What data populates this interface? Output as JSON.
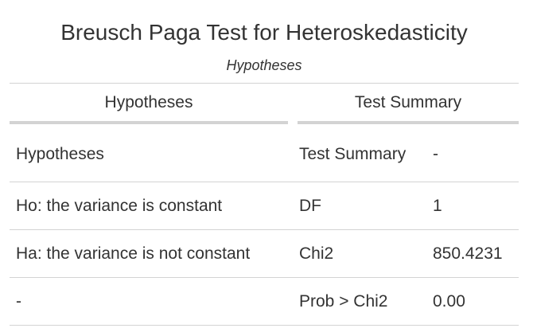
{
  "table": {
    "title": "Breusch Paga Test for Heteroskedasticity",
    "subtitle": "Hypotheses",
    "spanners": [
      "Hypotheses",
      "Test Summary"
    ],
    "rows": [
      [
        "Hypotheses",
        "Test Summary",
        "-"
      ],
      [
        "Ho: the variance is constant",
        "DF",
        "1"
      ],
      [
        "Ha: the variance is not constant",
        "Chi2",
        "850.4231"
      ],
      [
        "-",
        "Prob > Chi2",
        "0.00"
      ]
    ]
  },
  "colors": {
    "text": "#333333",
    "rule": "#d3d3d3",
    "background": "#ffffff"
  }
}
